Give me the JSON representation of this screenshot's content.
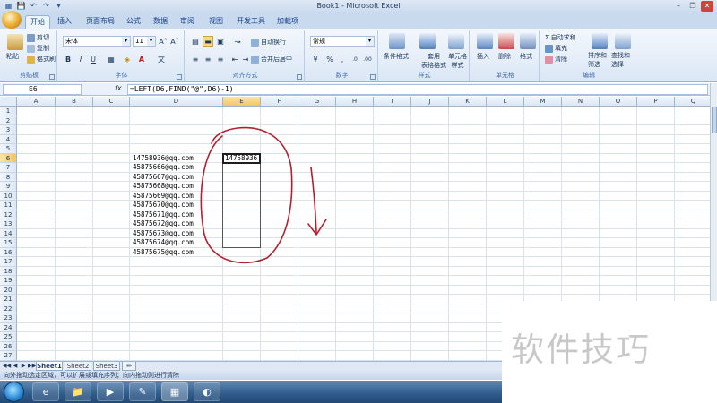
{
  "window": {
    "title": "Book1 - Microsoft Excel",
    "qat_icons": [
      "excel-logo-icon",
      "save-icon",
      "undo-icon",
      "redo-icon",
      "customize-qat-icon"
    ],
    "controls": [
      "minimize-icon",
      "restore-icon",
      "close-icon"
    ]
  },
  "ribbon_tabs": [
    "开始",
    "插入",
    "页面布局",
    "公式",
    "数据",
    "审阅",
    "视图",
    "开发工具",
    "加载项"
  ],
  "active_tab": "开始",
  "ribbon": {
    "clipboard": {
      "label": "剪贴板",
      "paste": "粘贴",
      "cut": "剪切",
      "copy": "复制",
      "format_painter": "格式刷"
    },
    "font": {
      "label": "字体",
      "name": "宋体",
      "size": "11",
      "bold": "B",
      "italic": "I",
      "underline": "U",
      "grow": "A˄",
      "shrink": "A˅",
      "font_color": "A",
      "phonetic": "文"
    },
    "alignment": {
      "label": "对齐方式",
      "wrap_text": "自动换行",
      "merge_center": "合并后居中"
    },
    "number": {
      "label": "数字",
      "format": "常规",
      "percent": "%",
      "comma": ",",
      "inc_decimal": ".0",
      "dec_decimal": ".00"
    },
    "styles": {
      "label": "样式",
      "conditional": "条件格式",
      "format_table_1": "套用",
      "format_table_2": "表格格式",
      "cell_styles_1": "单元格",
      "cell_styles_2": "样式"
    },
    "cells": {
      "label": "单元格",
      "insert": "插入",
      "delete": "删除",
      "format": "格式"
    },
    "editing": {
      "label": "编辑",
      "autosum": "自动求和",
      "fill": "填充",
      "clear": "清除",
      "sort_1": "排序和",
      "sort_2": "筛选",
      "find_1": "查找和",
      "find_2": "选择"
    }
  },
  "formula_bar": {
    "name_box": "E6",
    "fx": "fx",
    "formula": "=LEFT(D6,FIND(\"@\",D6)-1)"
  },
  "grid": {
    "columns": [
      "A",
      "B",
      "C",
      "D",
      "E",
      "F",
      "G",
      "H",
      "I",
      "J",
      "K",
      "L",
      "M",
      "N",
      "O",
      "P",
      "Q"
    ],
    "selected_column": "E",
    "rows": [
      "1",
      "2",
      "3",
      "4",
      "5",
      "6",
      "7",
      "8",
      "9",
      "10",
      "11",
      "12",
      "13",
      "14",
      "15",
      "16",
      "17",
      "18",
      "19",
      "20",
      "21",
      "22",
      "23",
      "24",
      "25",
      "26",
      "27"
    ],
    "selected_row": "6",
    "emails": [
      "14758936@qq.com",
      "45875666@qq.com",
      "45875667@qq.com",
      "45875668@qq.com",
      "45875669@qq.com",
      "45875670@qq.com",
      "45875671@qq.com",
      "45875672@qq.com",
      "45875673@qq.com",
      "45875674@qq.com",
      "45875675@qq.com"
    ],
    "active_cell_value": "14758936"
  },
  "sheets": [
    "Sheet1",
    "Sheet2",
    "Sheet3"
  ],
  "active_sheet": "Sheet1",
  "status_text": "向外拖动选定区域，可以扩展或填充序列；向内拖动则进行清除",
  "taskbar_apps": [
    "ie-icon",
    "folder-icon",
    "media-player-icon",
    "document-icon",
    "excel-icon",
    "paint-icon"
  ],
  "watermark": "软件技巧",
  "colors": {
    "annotation": "#b22030",
    "ribbon_active_tab": "#eef4fb",
    "header_selected": "#f4c55f"
  }
}
